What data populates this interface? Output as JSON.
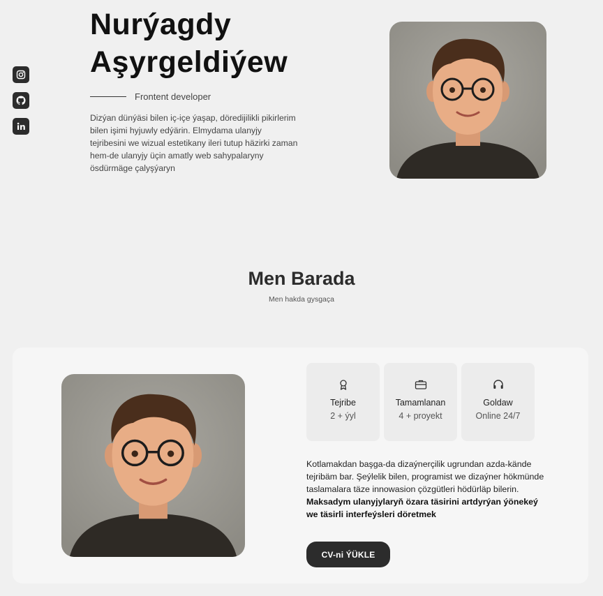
{
  "hero": {
    "name_line1": "Nurýagdy",
    "name_line2": "Aşyrgeldiýew",
    "role": "Frontent developer",
    "description": "Dizýan dünýäsi bilen iç-içe ýaşap, döredijilikli pikirlerim bilen işimi hyjuwly edýärin. Elmydama ulanyjy tejribesini we wizual estetikany ileri tutup häzirki zaman hem-de ulanyjy üçin amatly web sahypalaryny ösdürmäge çalyşýaryn"
  },
  "social": [
    {
      "icon": "instagram-icon"
    },
    {
      "icon": "github-icon"
    },
    {
      "icon": "linkedin-icon"
    }
  ],
  "about": {
    "title": "Men Barada",
    "subtitle": "Men hakda gysgaça",
    "stats": [
      {
        "icon": "award-icon",
        "title": "Tejribe",
        "value": "2 + ýyl"
      },
      {
        "icon": "briefcase-icon",
        "title": "Tamamlanan",
        "value": "4 + proyekt"
      },
      {
        "icon": "headset-icon",
        "title": "Goldaw",
        "value": "Online 24/7"
      }
    ],
    "text_normal": "Kotlamakdan başga-da dizaýnerçilik ugrundan azda-kände tejribäm bar. Şeýlelik bilen, programist we dizaýner hökmünde taslamalara täze innowasion çözgütleri hödürläp bilerin. ",
    "text_bold": "Maksadym ulanyjylaryň özara täsirini artdyrýan ýönekeý we täsirli interfeýsleri döretmek",
    "cv_button": "CV-ni ÝÜKLE"
  },
  "colors": {
    "background": "#f0f0f0",
    "dark": "#2c2c2c",
    "card": "#f6f6f6",
    "stat_box": "#ececec"
  }
}
